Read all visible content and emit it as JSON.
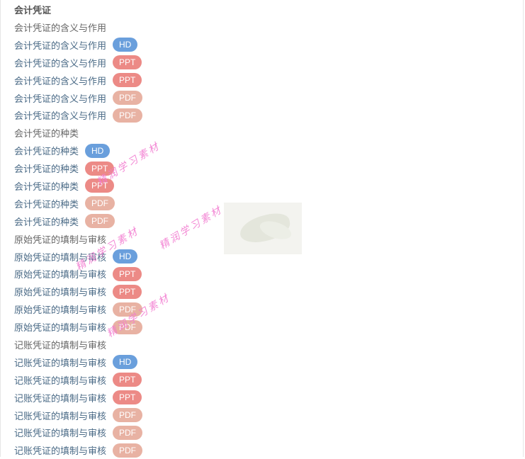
{
  "heading": "会计凭证",
  "rows": [
    {
      "type": "section",
      "text": "会计凭证的含义与作用"
    },
    {
      "type": "item",
      "text": "会计凭证的含义与作用",
      "badge": "HD"
    },
    {
      "type": "item",
      "text": "会计凭证的含义与作用",
      "badge": "PPT"
    },
    {
      "type": "item",
      "text": "会计凭证的含义与作用",
      "badge": "PPT"
    },
    {
      "type": "item",
      "text": "会计凭证的含义与作用",
      "badge": "PDF"
    },
    {
      "type": "item",
      "text": "会计凭证的含义与作用",
      "badge": "PDF"
    },
    {
      "type": "section",
      "text": "会计凭证的种类"
    },
    {
      "type": "item",
      "text": "会计凭证的种类",
      "badge": "HD"
    },
    {
      "type": "item",
      "text": "会计凭证的种类",
      "badge": "PPT"
    },
    {
      "type": "item",
      "text": "会计凭证的种类",
      "badge": "PPT"
    },
    {
      "type": "item",
      "text": "会计凭证的种类",
      "badge": "PDF"
    },
    {
      "type": "item",
      "text": "会计凭证的种类",
      "badge": "PDF"
    },
    {
      "type": "section",
      "text": "原始凭证的填制与审核"
    },
    {
      "type": "item",
      "text": "原始凭证的填制与审核",
      "badge": "HD"
    },
    {
      "type": "item",
      "text": "原始凭证的填制与审核",
      "badge": "PPT"
    },
    {
      "type": "item",
      "text": "原始凭证的填制与审核",
      "badge": "PPT"
    },
    {
      "type": "item",
      "text": "原始凭证的填制与审核",
      "badge": "PDF"
    },
    {
      "type": "item",
      "text": "原始凭证的填制与审核",
      "badge": "PDF"
    },
    {
      "type": "section",
      "text": "记账凭证的填制与审核"
    },
    {
      "type": "item",
      "text": "记账凭证的填制与审核",
      "badge": "HD"
    },
    {
      "type": "item",
      "text": "记账凭证的填制与审核",
      "badge": "PPT"
    },
    {
      "type": "item",
      "text": "记账凭证的填制与审核",
      "badge": "PPT"
    },
    {
      "type": "item",
      "text": "记账凭证的填制与审核",
      "badge": "PDF"
    },
    {
      "type": "item",
      "text": "记账凭证的填制与审核",
      "badge": "PDF"
    },
    {
      "type": "item",
      "text": "记账凭证的填制与审核",
      "badge": "PDF"
    }
  ],
  "watermark": "精润学习素材",
  "colors": {
    "hd": "#6a9fdc",
    "ppt": "#ec8a86",
    "pdf": "#e8b2a3",
    "link": "#4a6a86",
    "watermark": "#f27bd0"
  }
}
